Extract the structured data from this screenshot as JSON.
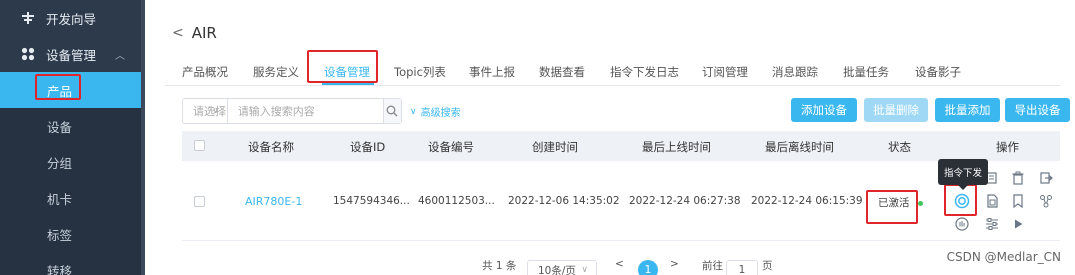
{
  "sidebar": {
    "top_item": {
      "label": "开发向导",
      "icon": "wizard-icon"
    },
    "group": {
      "label": "设备管理",
      "icon": "devices-grid-icon"
    },
    "items": [
      {
        "label": "产品"
      },
      {
        "label": "设备"
      },
      {
        "label": "分组"
      },
      {
        "label": "机卡"
      },
      {
        "label": "标签"
      },
      {
        "label": "转移"
      }
    ]
  },
  "header": {
    "back_title": "AIR"
  },
  "tabs": [
    "产品概况",
    "服务定义",
    "设备管理",
    "Topic列表",
    "事件上报",
    "数据查看",
    "指令下发日志",
    "订阅管理",
    "消息跟踪",
    "批量任务",
    "设备影子"
  ],
  "search": {
    "select_placeholder": "请选择",
    "input_placeholder": "请输入搜索内容",
    "advanced_label": "高级搜索"
  },
  "actions": {
    "add": "添加设备",
    "batch_delete": "批量删除",
    "batch_add": "批量添加",
    "export": "导出设备"
  },
  "table": {
    "headers": [
      "设备名称",
      "设备ID",
      "设备编号",
      "创建时间",
      "最后上线时间",
      "最后离线时间",
      "状态",
      "操作"
    ],
    "rows": [
      {
        "name": "AIR780E-1",
        "id": "1547594346...",
        "number": "4600112503...",
        "created": "2022-12-06 14:35:02",
        "last_online": "2022-12-24 06:27:38",
        "last_offline": "2022-12-24 06:15:39",
        "status": "已激活"
      }
    ]
  },
  "tooltip": "指令下发",
  "pagination": {
    "total": "共 1 条",
    "page_size": "10条/页",
    "current_page": "1",
    "goto_label": "前往",
    "goto_value": "1",
    "page_suffix": "页"
  },
  "watermark": "CSDN @Medlar_CN",
  "colors": {
    "accent": "#3ab7ef",
    "sidebar": "#2d3a4b",
    "highlight_box": "#e0262b",
    "status_online": "#42c35c"
  }
}
